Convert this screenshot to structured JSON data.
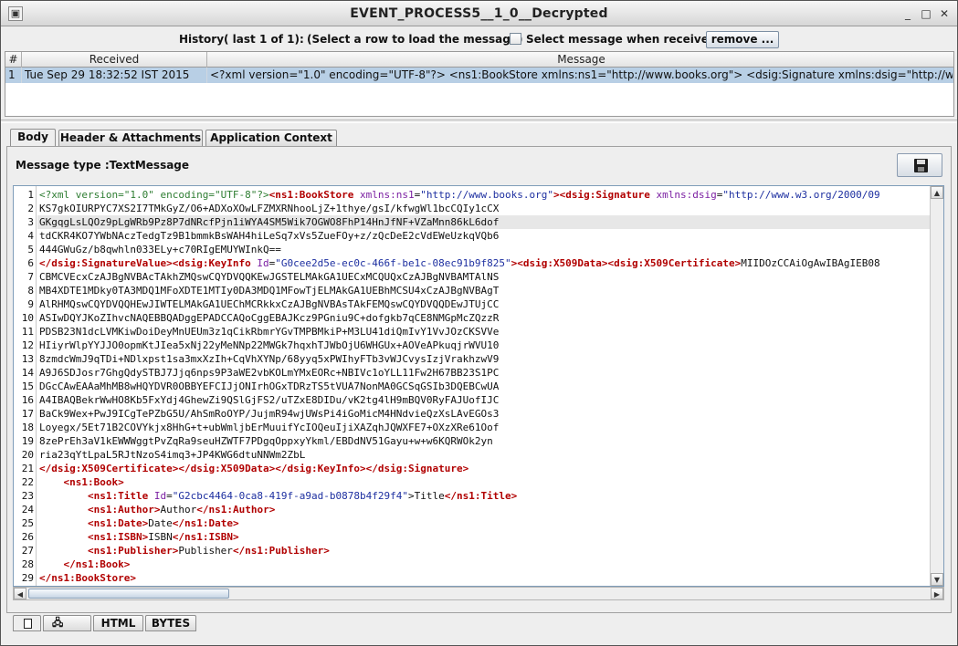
{
  "window": {
    "title": "EVENT_PROCESS5__1_0__Decrypted",
    "minimize": "_",
    "maximize": "□",
    "close": "✕",
    "app_icon": "▣"
  },
  "history": {
    "label": "History( last 1 of 1):",
    "hint": "(Select a row to load the message)",
    "checkbox_label": "Select message when received",
    "checkbox_checked": false,
    "remove_label": "remove ..."
  },
  "table": {
    "columns": [
      "#",
      "Received",
      "Message"
    ],
    "rows": [
      {
        "index": "1",
        "received": "Tue Sep 29 18:32:52 IST 2015",
        "message": "<?xml version=\"1.0\" encoding=\"UTF-8\"?> <ns1:BookStore xmlns:ns1=\"http://www.books.org\"> <dsig:Signature xmlns:dsig=\"http://www...."
      }
    ]
  },
  "tabs": [
    "Body",
    "Header & Attachments",
    "Application Context"
  ],
  "active_tab": "Body",
  "message_type": "Message type :TextMessage",
  "save_icon": "floppy-disk-icon",
  "code_lines": [
    [
      [
        "pi",
        "<?xml version=\"1.0\" encoding=\"UTF-8\"?>"
      ],
      [
        "tag",
        "<ns1:BookStore "
      ],
      [
        "attr",
        "xmlns:ns1"
      ],
      [
        "text",
        "="
      ],
      [
        "val",
        "\"http://www.books.org\""
      ],
      [
        "tag",
        ">"
      ],
      [
        "tag",
        "<dsig:Signature "
      ],
      [
        "attr",
        "xmlns:dsig"
      ],
      [
        "text",
        "="
      ],
      [
        "val",
        "\"http://www.w3.org/2000/09"
      ]
    ],
    [
      [
        "text",
        "KS7gkOIURPYC7XS2I7TMkGyZ/O6+ADXoXOwLFZMXRNhooLjZ+1thye/gsI/kfwgWl1bcCQIy1cCX"
      ]
    ],
    [
      [
        "text",
        "GKgqgLsLQOz9pLgWRb9Pz8P7dNRcfPjn1iWYA4SM5Wik7OGWO8FhP14HnJfNF+VZaMnn86kL6dof"
      ]
    ],
    [
      [
        "text",
        "tdCKR4KO7YWbNAczTedgTz9B1bmmkBsWAH4hiLeSq7xVs5ZueFOy+z/zQcDeE2cVdEWeUzkqVQb6"
      ]
    ],
    [
      [
        "text",
        "444GWuGz/b8qwhln033ELy+c70RIgEMUYWInkQ=="
      ]
    ],
    [
      [
        "tag",
        "</dsig:SignatureValue>"
      ],
      [
        "tag",
        "<dsig:KeyInfo "
      ],
      [
        "attr",
        "Id"
      ],
      [
        "text",
        "="
      ],
      [
        "val",
        "\"G0cee2d5e-ec0c-466f-be1c-08ec91b9f825\""
      ],
      [
        "tag",
        ">"
      ],
      [
        "tag",
        "<dsig:X509Data>"
      ],
      [
        "tag",
        "<dsig:X509Certificate>"
      ],
      [
        "text",
        "MIIDOzCCAiOgAwIBAgIEB08"
      ]
    ],
    [
      [
        "text",
        "CBMCVEcxCzAJBgNVBAcTAkhZMQswCQYDVQQKEwJGSTELMAkGA1UECxMCQUQxCzAJBgNVBAMTAlNS"
      ]
    ],
    [
      [
        "text",
        "MB4XDTE1MDky0TA3MDQ1MFoXDTE1MTIy0DA3MDQ1MFowTjELMAkGA1UEBhMCSU4xCzAJBgNVBAgT"
      ]
    ],
    [
      [
        "text",
        "AlRHMQswCQYDVQQHEwJIWTELMAkGA1UEChMCRkkxCzAJBgNVBAsTAkFEMQswCQYDVQQDEwJTUjCC"
      ]
    ],
    [
      [
        "text",
        "ASIwDQYJKoZIhvcNAQEBBQADggEPADCCAQoCggEBAJKcz9PGniu9C+dofgkb7qCE8NMGpMcZQzzR"
      ]
    ],
    [
      [
        "text",
        "PDSB23N1dcLVMKiwDoiDeyMnUEUm3z1qCikRbmrYGvTMPBMkiP+M3LU41diQmIvY1VvJOzCKSVVe"
      ]
    ],
    [
      [
        "text",
        "HIiyrWlpYYJJO0opmKtJIea5xNj22yMeNNp22MWGk7hqxhTJWbOjU6WHGUx+AOVeAPkuqjrWVU10"
      ]
    ],
    [
      [
        "text",
        "8zmdcWmJ9qTDi+NDlxpst1sa3mxXzIh+CqVhXYNp/68yyq5xPWIhyFTb3vWJCvysIzjVrakhzwV9"
      ]
    ],
    [
      [
        "text",
        "A9J6SDJosr7GhgQdySTBJ7Jjq6nps9P3aWE2vbKOLmYMxEORc+NBIVc1oYLL11Fw2H67BB23S1PC"
      ]
    ],
    [
      [
        "text",
        "DGcCAwEAAaMhMB8wHQYDVR0OBBYEFCIJjONIrhOGxTDRzTS5tVUA7NonMA0GCSqGSIb3DQEBCwUA"
      ]
    ],
    [
      [
        "text",
        "A4IBAQBekrWwHO8Kb5FxYdj4GhewZi9QSlGjFS2/uTZxE8DIDu/vK2tg4lH9mBQV0RyFAJUofIJC"
      ]
    ],
    [
      [
        "text",
        "BaCk9Wex+PwJ9ICgTePZbG5U/AhSmRoOYP/JujmR94wjUWsPi4iGoMicM4HNdvieQzXsLAvEGOs3"
      ]
    ],
    [
      [
        "text",
        "Loyegx/5Et71B2COVYkjx8HhG+t+ubWmljbErMuuifYcIOQeuIjiXAZqhJQWXFE7+OXzXRe61Oof"
      ]
    ],
    [
      [
        "text",
        "8zePrEh3aV1kEWWWggtPvZqRa9seuHZWTF7PDgqOppxyYkml/EBDdNV51Gayu+w+w6KQRWOk2yn"
      ]
    ],
    [
      [
        "text",
        "ria23qYtLpaL5RJtNzoS4imq3+JP4KWG6dtuNNWm2ZbL"
      ]
    ],
    [
      [
        "tag",
        "</dsig:X509Certificate>"
      ],
      [
        "tag",
        "</dsig:X509Data>"
      ],
      [
        "tag",
        "</dsig:KeyInfo>"
      ],
      [
        "tag",
        "</dsig:Signature>"
      ]
    ],
    [
      [
        "text",
        "    "
      ],
      [
        "tag",
        "<ns1:Book>"
      ]
    ],
    [
      [
        "text",
        "        "
      ],
      [
        "tag",
        "<ns1:Title "
      ],
      [
        "attr",
        "Id"
      ],
      [
        "text",
        "="
      ],
      [
        "val",
        "\"G2cbc4464-0ca8-419f-a9ad-b0878b4f29f4\""
      ],
      [
        "text",
        ">Title"
      ],
      [
        "tag",
        "</ns1:Title>"
      ]
    ],
    [
      [
        "text",
        "        "
      ],
      [
        "tag",
        "<ns1:Author>"
      ],
      [
        "text",
        "Author"
      ],
      [
        "tag",
        "</ns1:Author>"
      ]
    ],
    [
      [
        "text",
        "        "
      ],
      [
        "tag",
        "<ns1:Date>"
      ],
      [
        "text",
        "Date"
      ],
      [
        "tag",
        "</ns1:Date>"
      ]
    ],
    [
      [
        "text",
        "        "
      ],
      [
        "tag",
        "<ns1:ISBN>"
      ],
      [
        "text",
        "ISBN"
      ],
      [
        "tag",
        "</ns1:ISBN>"
      ]
    ],
    [
      [
        "text",
        "        "
      ],
      [
        "tag",
        "<ns1:Publisher>"
      ],
      [
        "text",
        "Publisher"
      ],
      [
        "tag",
        "</ns1:Publisher>"
      ]
    ],
    [
      [
        "text",
        "    "
      ],
      [
        "tag",
        "</ns1:Book>"
      ]
    ],
    [
      [
        "tag",
        "</ns1:BookStore>"
      ]
    ]
  ],
  "current_line": 3,
  "view_tabs": [
    "",
    "",
    "HTML",
    "BYTES"
  ],
  "view_tab_icons": [
    "document-icon",
    "tree-icon"
  ]
}
